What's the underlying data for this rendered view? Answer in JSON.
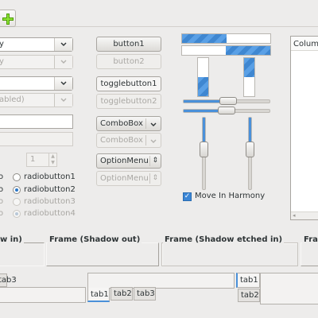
{
  "toolbar": {
    "add_icon": "green-plus-icon"
  },
  "col1": {
    "combo1": "y",
    "combo2": "y",
    "combo3": "",
    "combo4": "abled)",
    "entry1": "",
    "entry2": "",
    "spin": {
      "value": "1"
    },
    "radios": [
      {
        "suffix": "o",
        "label": "radiobutton1",
        "checked": false,
        "disabled": false
      },
      {
        "suffix": "o",
        "label": "radiobutton2",
        "checked": true,
        "disabled": false
      },
      {
        "suffix": "o",
        "label": "radiobutton3",
        "checked": false,
        "disabled": true
      },
      {
        "suffix": "o",
        "label": "radiobutton4",
        "checked": true,
        "disabled": true
      }
    ]
  },
  "col2": {
    "button1": "button1",
    "button2": "button2",
    "toggle1": "togglebutton1",
    "toggle2": "togglebutton2",
    "combobox1": "ComboBox",
    "combobox2": "ComboBox",
    "optionmenu1": "OptionMenu",
    "optionmenu2": "OptionMenu"
  },
  "col3": {
    "progress_h1": 0.5,
    "progress_h2": 0.5,
    "progress_v1": 0.5,
    "progress_v2": 0.5,
    "scale_h1": 0.52,
    "scale_h2": 0.5,
    "scale_v1": 0.43,
    "scale_v2": 0.43,
    "harmony_label": "Move In Harmony",
    "harmony_checked": true
  },
  "col4": {
    "column_header": "Column"
  },
  "frames": {
    "in": "w in)",
    "out": "Frame (Shadow out)",
    "etched_in": "Frame (Shadow etched in)",
    "etched_out": "Fra"
  },
  "tabs_a": [
    "tab3"
  ],
  "tabs_b": [
    "tab1",
    "tab2",
    "tab3"
  ],
  "tabs_c": [
    "tab1",
    "tab2"
  ]
}
